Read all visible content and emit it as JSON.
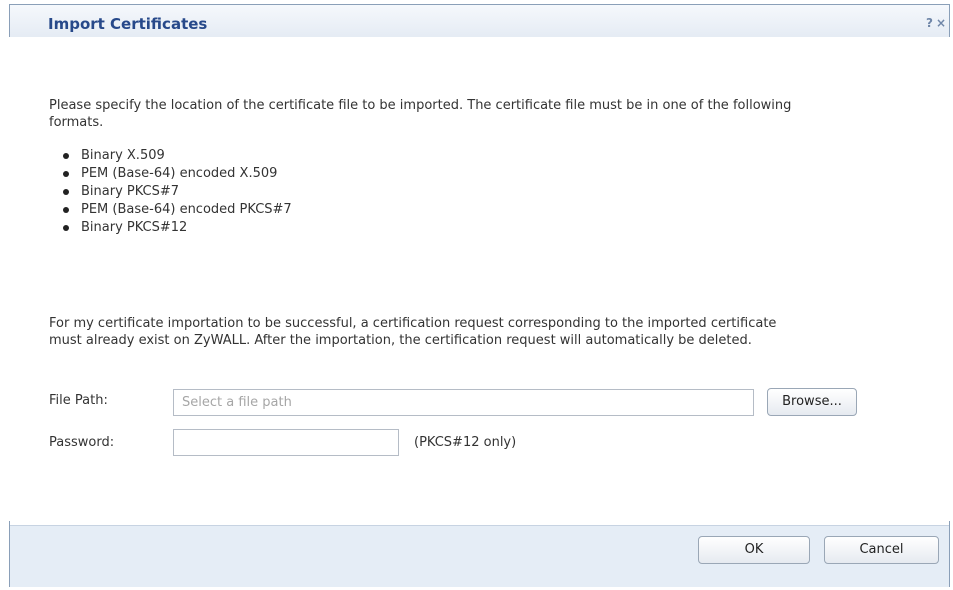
{
  "dialog": {
    "title": "Import Certificates",
    "help_icon": "?",
    "close_icon": "×"
  },
  "content": {
    "intro": "Please specify the location of the certificate file to be imported. The certificate file must be in one of the following formats.",
    "formats": [
      "Binary X.509",
      "PEM (Base-64) encoded X.509",
      "Binary PKCS#7",
      "PEM (Base-64) encoded PKCS#7",
      "Binary PKCS#12"
    ],
    "note": "For my certificate importation to be successful, a certification request corresponding to the imported certificate must already exist on ZyWALL. After the importation, the certification request will automatically be deleted."
  },
  "form": {
    "file_path_label": "File Path:",
    "file_path_placeholder": "Select a file path",
    "browse_label": "Browse...",
    "password_label": "Password:",
    "password_value": "",
    "password_hint": "(PKCS#12 only)"
  },
  "footer": {
    "ok_label": "OK",
    "cancel_label": "Cancel"
  }
}
